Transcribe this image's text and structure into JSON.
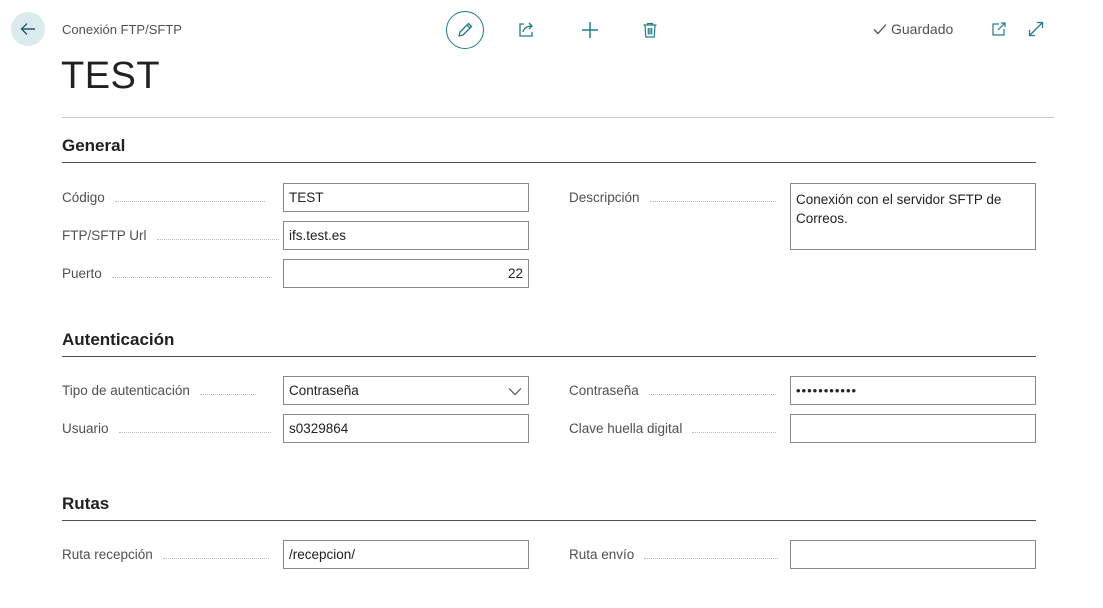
{
  "header": {
    "breadcrumb": "Conexión FTP/SFTP",
    "title": "TEST",
    "saved_status": "Guardado"
  },
  "icons": {
    "back": "arrow-left-icon",
    "edit": "pencil-icon",
    "share": "share-icon",
    "new": "plus-icon",
    "delete": "trash-icon",
    "saved": "checkmark-icon",
    "open_new_window": "open-in-new-window-icon",
    "expand": "expand-icon",
    "dropdown": "chevron-down-icon"
  },
  "colors": {
    "accent": "#1e7d88",
    "back_button_bg": "#dbeaee"
  },
  "sections": {
    "general": {
      "title": "General",
      "codigo_label": "Código",
      "codigo_value": "TEST",
      "url_label": "FTP/SFTP Url",
      "url_value": "ifs.test.es",
      "puerto_label": "Puerto",
      "puerto_value": "22",
      "descripcion_label": "Descripción",
      "descripcion_value": "Conexión con el servidor SFTP de Correos."
    },
    "auth": {
      "title": "Autenticación",
      "tipo_label": "Tipo de autenticación",
      "tipo_value": "Contraseña",
      "usuario_label": "Usuario",
      "usuario_value": "s0329864",
      "password_label": "Contraseña",
      "password_value": "•••••••••••",
      "fingerprint_label": "Clave huella digital",
      "fingerprint_value": ""
    },
    "paths": {
      "title": "Rutas",
      "recepcion_label": "Ruta recepción",
      "recepcion_value": "/recepcion/",
      "envio_label": "Ruta envío",
      "envio_value": ""
    }
  }
}
